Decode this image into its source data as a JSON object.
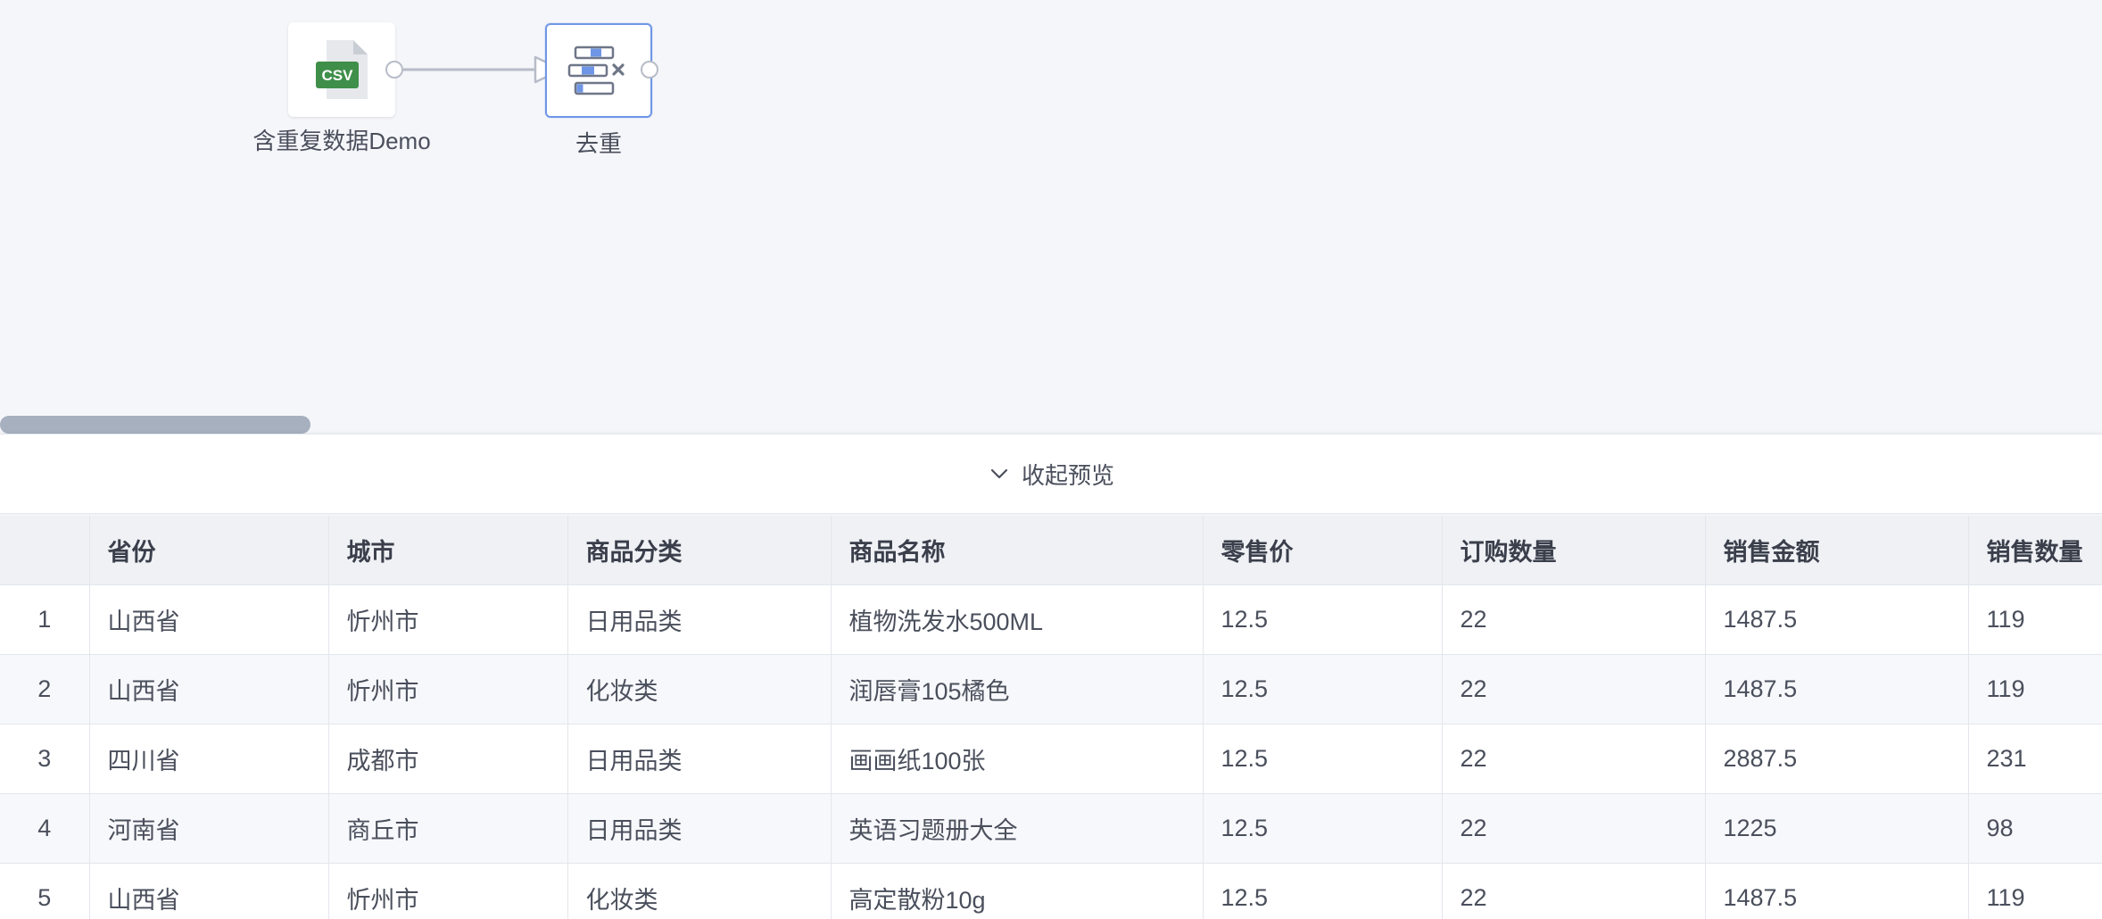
{
  "canvas": {
    "nodes": [
      {
        "id": "csv",
        "label": "含重复数据Demo",
        "icon": "csv-file-icon",
        "icon_text": "CSV"
      },
      {
        "id": "dedupe",
        "label": "去重",
        "icon": "deduplicate-icon"
      }
    ]
  },
  "preview": {
    "toggle_label": "收起预览",
    "icon": "chevron-down-icon"
  },
  "table": {
    "columns": [
      "",
      "省份",
      "城市",
      "商品分类",
      "商品名称",
      "零售价",
      "订购数量",
      "销售金额",
      "销售数量"
    ],
    "rows": [
      [
        "1",
        "山西省",
        "忻州市",
        "日用品类",
        "植物洗发水500ML",
        "12.5",
        "22",
        "1487.5",
        "119"
      ],
      [
        "2",
        "山西省",
        "忻州市",
        "化妆类",
        "润唇膏105橘色",
        "12.5",
        "22",
        "1487.5",
        "119"
      ],
      [
        "3",
        "四川省",
        "成都市",
        "日用品类",
        "画画纸100张",
        "12.5",
        "22",
        "2887.5",
        "231"
      ],
      [
        "4",
        "河南省",
        "商丘市",
        "日用品类",
        "英语习题册大全",
        "12.5",
        "22",
        "1225",
        "98"
      ],
      [
        "5",
        "山西省",
        "忻州市",
        "化妆类",
        "高定散粉10g",
        "12.5",
        "22",
        "1487.5",
        "119"
      ]
    ]
  },
  "colors": {
    "accent": "#6f96e6",
    "csv_green": "#3f8f4a",
    "header_bg": "#eff1f5"
  }
}
